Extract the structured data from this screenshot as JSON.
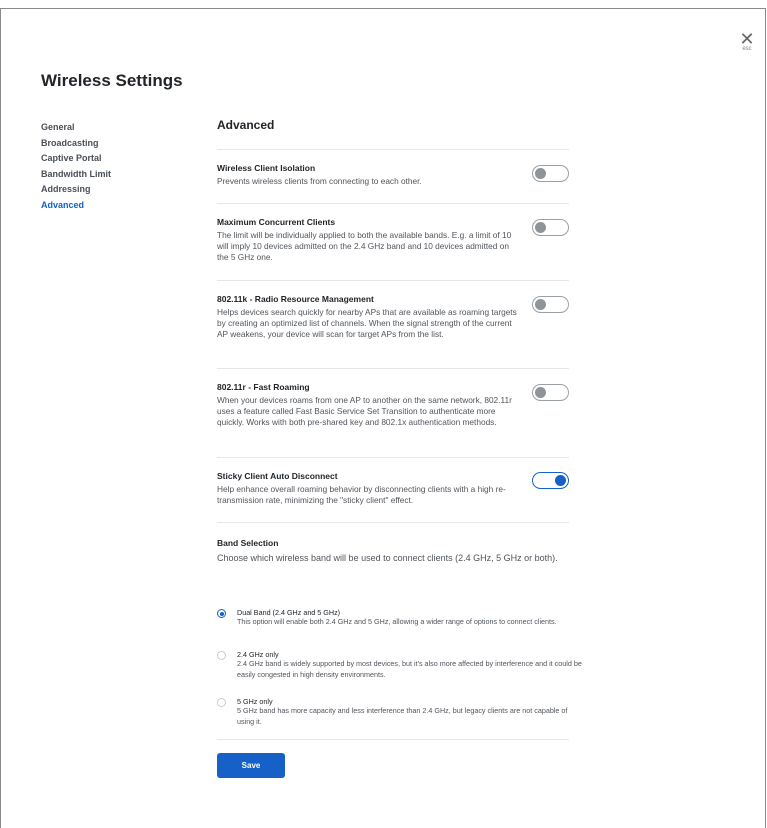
{
  "close": {
    "icon": "close-icon",
    "label": "esc"
  },
  "page_title": "Wireless Settings",
  "sidebar": {
    "items": [
      {
        "label": "General",
        "active": false
      },
      {
        "label": "Broadcasting",
        "active": false
      },
      {
        "label": "Captive Portal",
        "active": false
      },
      {
        "label": "Bandwidth Limit",
        "active": false
      },
      {
        "label": "Addressing",
        "active": false
      },
      {
        "label": "Advanced",
        "active": true
      }
    ]
  },
  "section_title": "Advanced",
  "settings": [
    {
      "title": "Wireless Client Isolation",
      "description": "Prevents wireless clients from connecting to each other.",
      "enabled": false
    },
    {
      "title": "Maximum Concurrent Clients",
      "description": "The limit will be individually applied to both the available bands. E.g. a limit of 10 will imply 10 devices admitted on the 2.4 GHz band and 10 devices admitted on the 5 GHz one.",
      "enabled": false
    },
    {
      "title": "802.11k - Radio Resource Management",
      "description": "Helps devices search quickly for nearby APs that are available as roaming targets by creating an optimized list of channels. When the signal strength of the current AP weakens, your device will scan for target APs from the list.",
      "enabled": false
    },
    {
      "title": "802.11r - Fast Roaming",
      "description": "When your devices roams from one AP to another on the same network, 802.11r uses a feature called Fast Basic Service Set Transition to authenticate more quickly. Works with both pre-shared key and 802.1x authentication methods.",
      "enabled": false
    },
    {
      "title": "Sticky Client Auto Disconnect",
      "description": "Help enhance overall roaming behavior by disconnecting clients with a high re-transmission rate, minimizing the \"sticky client\" effect.",
      "enabled": true
    }
  ],
  "band_selection": {
    "title": "Band Selection",
    "description": "Choose which wireless band will be used to connect clients (2.4 GHz, 5 GHz or both).",
    "options": [
      {
        "label": "Dual Band (2.4 GHz and 5 GHz)",
        "description": "This option will enable both 2.4 GHz and 5 GHz, allowing a wider range of options to connect clients.",
        "selected": true
      },
      {
        "label": "2.4 GHz only",
        "description": "2.4 GHz band is widely supported by most devices, but it's also more affected by interference and it could be easily congested in high density environments.",
        "selected": false
      },
      {
        "label": "5 GHz only",
        "description": "5 GHz band has more capacity and less interference than 2.4 GHz, but legacy clients are not capable of using it.",
        "selected": false
      }
    ]
  },
  "save_label": "Save",
  "colors": {
    "accent": "#1561c8",
    "active_nav": "#1060c9",
    "toggle_off": "#8f9499"
  }
}
